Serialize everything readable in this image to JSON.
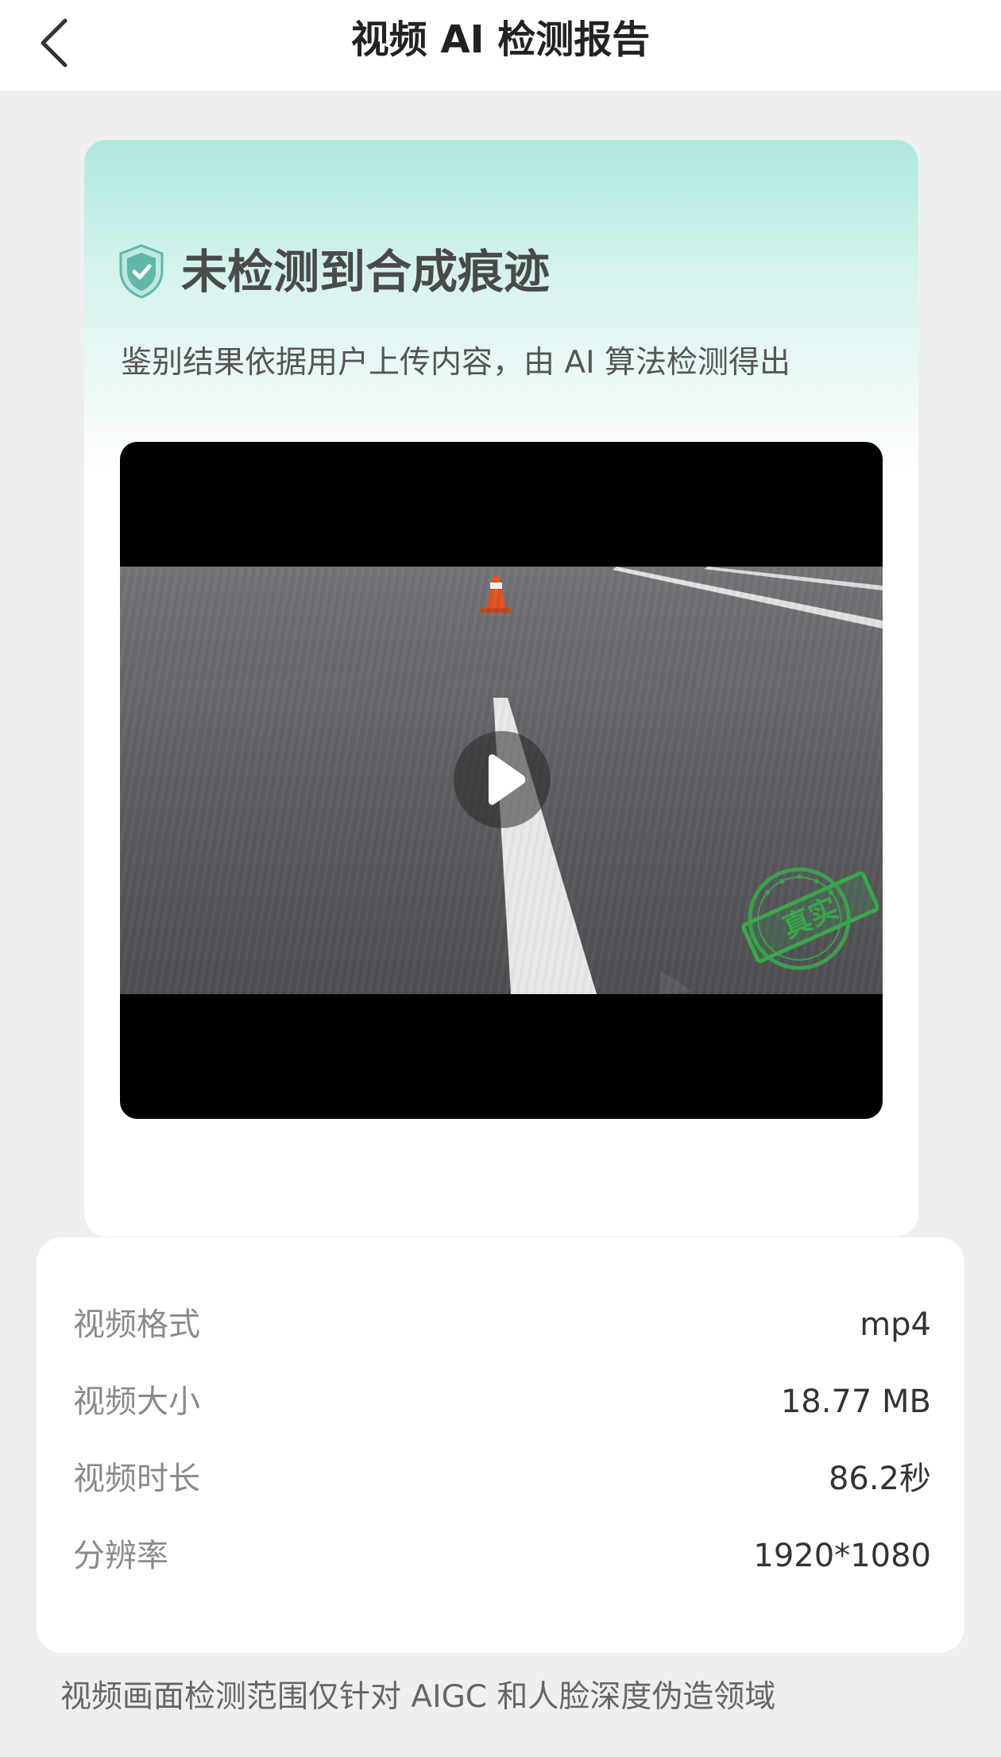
{
  "header": {
    "title": "视频 AI 检测报告",
    "back_icon": "chevron-left-icon"
  },
  "result": {
    "icon": "shield-check-icon",
    "title": "未检测到合成痕迹",
    "subtitle": "鉴别结果依据用户上传内容，由 AI 算法检测得出",
    "accent_color": "#5fb8a8",
    "stamp_label": "真实",
    "stamp_color": "#3aa64a"
  },
  "video": {
    "play_icon": "play-icon"
  },
  "info": {
    "rows": [
      {
        "label": "视频格式",
        "value": "mp4"
      },
      {
        "label": "视频大小",
        "value": "18.77 MB"
      },
      {
        "label": "视频时长",
        "value": "86.2秒"
      },
      {
        "label": "分辨率",
        "value": "1920*1080"
      }
    ]
  },
  "footer": {
    "note": "视频画面检测范围仅针对 AIGC 和人脸深度伪造领域"
  }
}
